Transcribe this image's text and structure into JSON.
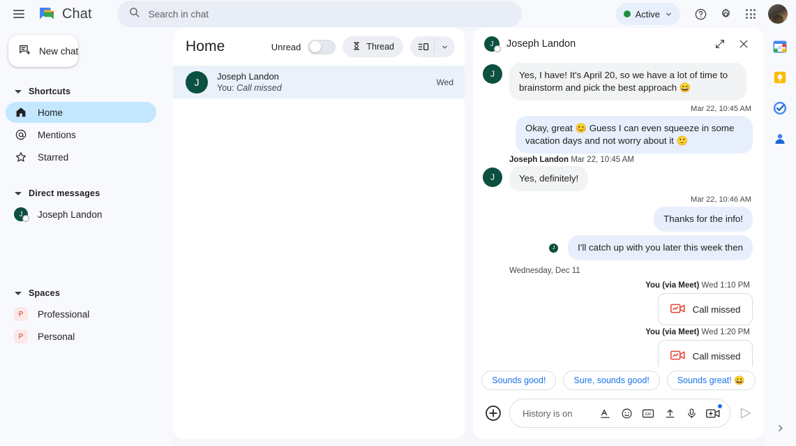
{
  "topbar": {
    "menu_icon": "hamburger-icon",
    "logo_icon": "google-chat-logo",
    "app_name": "Chat",
    "search_icon": "search-icon",
    "search_placeholder": "Search in chat",
    "search_value": "",
    "status_label": "Active",
    "status_color": "#1e8e3e",
    "status_caret_icon": "chevron-down-icon",
    "help_icon": "help-icon",
    "settings_icon": "gear-icon",
    "apps_icon": "apps-grid-icon",
    "account_icon": "user-avatar"
  },
  "sidebar": {
    "new_chat": {
      "label": "New chat",
      "icon": "new-chat-icon"
    },
    "sections": [
      {
        "title": "Shortcuts",
        "items": [
          {
            "label": "Home",
            "icon": "home-icon",
            "active": true
          },
          {
            "label": "Mentions",
            "icon": "at-mention-icon",
            "active": false
          },
          {
            "label": "Starred",
            "icon": "star-icon",
            "active": false
          }
        ]
      },
      {
        "title": "Direct messages",
        "items": [
          {
            "label": "Joseph Landon",
            "icon": "avatar",
            "initial": "J",
            "active": false
          }
        ]
      },
      {
        "title": "Spaces",
        "items": [
          {
            "label": "Professional",
            "icon": "space-avatar",
            "initial": "P",
            "active": false
          },
          {
            "label": "Personal",
            "icon": "space-avatar",
            "initial": "P",
            "active": false
          }
        ]
      }
    ]
  },
  "home_panel": {
    "title": "Home",
    "unread_label": "Unread",
    "unread_on": false,
    "thread_button": {
      "label": "Thread",
      "icon": "thread-icon"
    },
    "layout_button": {
      "icon": "split-view-icon",
      "caret_icon": "chevron-down-icon"
    },
    "rows": [
      {
        "initial": "J",
        "name": "Joseph Landon",
        "preview_prefix": "You:",
        "preview_text": "Call missed",
        "time": "Wed",
        "selected": true
      }
    ]
  },
  "conversation": {
    "header": {
      "initial": "J",
      "name": "Joseph Landon",
      "expand_icon": "expand-icon",
      "close_icon": "close-icon"
    },
    "messages": [
      {
        "type": "bubble",
        "side": "left",
        "initial": "J",
        "text": "Yes, I have! It's April 20, so we have a lot of time to brainstorm and pick the best approach 😄"
      },
      {
        "type": "timestamp",
        "side": "right",
        "text": "Mar 22, 10:45 AM"
      },
      {
        "type": "bubble",
        "side": "right",
        "text": "Okay, great 😊 Guess I can even squeeze in some vacation days and not worry about it 🙂"
      },
      {
        "type": "meta",
        "side": "left",
        "sender": "Joseph Landon",
        "time": "Mar 22, 10:45 AM"
      },
      {
        "type": "bubble",
        "side": "left",
        "initial": "J",
        "text": "Yes, definitely!"
      },
      {
        "type": "timestamp",
        "side": "right",
        "text": "Mar 22, 10:46 AM"
      },
      {
        "type": "bubble",
        "side": "right",
        "text": "Thanks for the info!"
      },
      {
        "type": "bubble",
        "side": "right",
        "text": "I'll catch up with you later this week then",
        "read_receipt_initial": "J"
      },
      {
        "type": "day-divider",
        "text": "Wednesday, Dec 11"
      },
      {
        "type": "meta",
        "side": "right",
        "sender": "You (via Meet)",
        "time": "Wed 1:10 PM"
      },
      {
        "type": "call-card",
        "side": "right",
        "label": "Call missed",
        "icon": "missed-video-call-icon"
      },
      {
        "type": "meta",
        "side": "right",
        "sender": "You (via Meet)",
        "time": "Wed 1:20 PM"
      },
      {
        "type": "call-card",
        "side": "right",
        "label": "Call missed",
        "icon": "missed-video-call-icon"
      }
    ],
    "smart_replies": [
      {
        "label": "Sounds good!"
      },
      {
        "label": "Sure, sounds good!"
      },
      {
        "label": "Sounds great! 😀"
      }
    ],
    "compose": {
      "add_icon": "plus-circle-icon",
      "placeholder": "History is on",
      "value": "",
      "icons": [
        {
          "name": "format-text-icon",
          "badge": false
        },
        {
          "name": "emoji-icon",
          "badge": false
        },
        {
          "name": "gif-icon",
          "badge": false
        },
        {
          "name": "upload-icon",
          "badge": false
        },
        {
          "name": "microphone-icon",
          "badge": false
        },
        {
          "name": "video-call-add-icon",
          "badge": true
        }
      ],
      "send_icon": "send-icon"
    }
  },
  "right_rail": {
    "items": [
      {
        "name": "google-calendar-icon"
      },
      {
        "name": "google-keep-icon"
      },
      {
        "name": "google-tasks-icon"
      },
      {
        "name": "google-contacts-icon"
      }
    ],
    "expand_icon": "chevron-right-icon"
  }
}
